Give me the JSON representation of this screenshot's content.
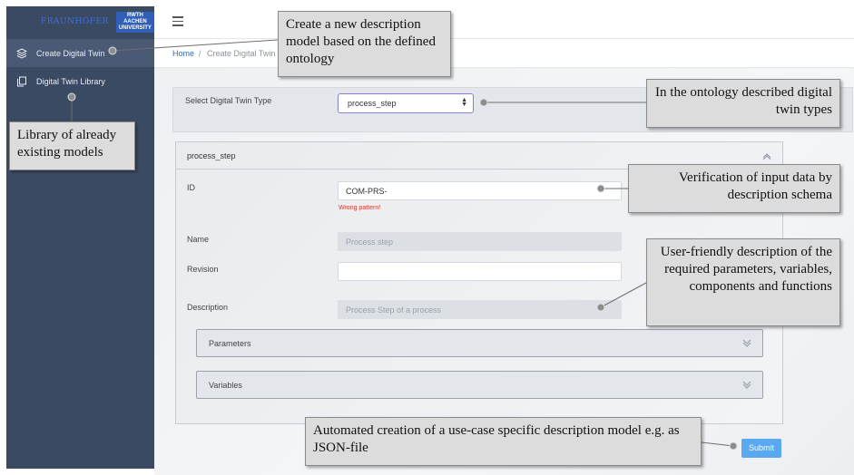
{
  "brand": {
    "left": "FRAUNHOFER",
    "right_line1": "RWTH AACHEN",
    "right_line2": "UNIVERSITY"
  },
  "sidebar": {
    "items": [
      {
        "label": "Create Digital Twin",
        "icon": "layers-icon",
        "active": true
      },
      {
        "label": "Digital Twin Library",
        "icon": "copy-icon",
        "active": false
      }
    ]
  },
  "breadcrumb": {
    "home": "Home",
    "separator": "/",
    "current": "Create Digital Twin"
  },
  "type_selector": {
    "label": "Select Digital Twin Type",
    "selected": "process_step"
  },
  "form": {
    "title": "process_step",
    "id_label": "ID",
    "id_value": "COM-PRS-",
    "id_error": "Wrong pattern!",
    "name_label": "Name",
    "name_value": "Process step",
    "revision_label": "Revision",
    "revision_value": "",
    "description_label": "Description",
    "description_value": "Process Step of a process",
    "sections": [
      {
        "label": "Parameters"
      },
      {
        "label": "Variables"
      }
    ]
  },
  "submit_label": "Submit",
  "callouts": {
    "create": "Create a new description model based on the defined ontology",
    "library": "Library of already existing models",
    "ontology": "In the ontology described digital twin types",
    "verification": "Verification of input data by description schema",
    "userfriendly": "User-friendly description of the required parameters, variables, components and functions",
    "automated": "Automated creation of a use-case specific description model e.g. as JSON-file"
  },
  "colors": {
    "sidebar": "#3b4a63",
    "accent": "#2b6fc9",
    "submit": "#5aa9f0",
    "error": "#d9362b",
    "select_border": "#8a7fd6"
  }
}
